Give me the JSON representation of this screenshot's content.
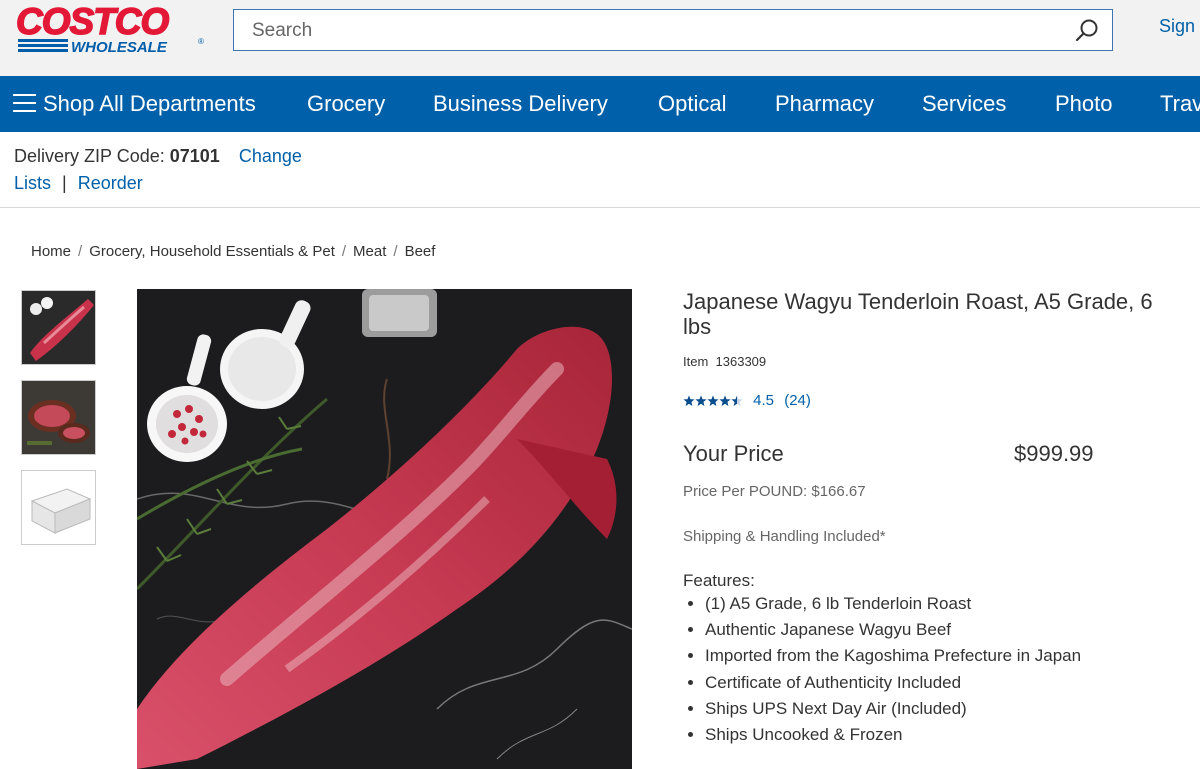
{
  "header": {
    "logo_text": "COSTCO",
    "logo_subtext": "WHOLESALE",
    "search_placeholder": "Search",
    "sign_in_label": "Sign",
    "colors": {
      "brand_red": "#e31837",
      "brand_blue": "#005daa",
      "header_bg": "#f2f2f2"
    }
  },
  "nav": {
    "shop_all": "Shop All Departments",
    "items": [
      "Grocery",
      "Business Delivery",
      "Optical",
      "Pharmacy",
      "Services",
      "Photo",
      "Trav"
    ],
    "bg_color": "#0060a9"
  },
  "delivery": {
    "zip_label": "Delivery ZIP Code:",
    "zip_code": "07101",
    "change_label": "Change",
    "lists_label": "Lists",
    "separator": "|",
    "reorder_label": "Reorder"
  },
  "breadcrumb": [
    "Home",
    "Grocery, Household Essentials & Pet",
    "Meat",
    "Beef"
  ],
  "product": {
    "title": "Japanese Wagyu Tenderloin Roast, A5 Grade, 6 lbs",
    "item_label": "Item",
    "item_number": "1363309",
    "rating_value": "4.5",
    "rating_count": "(24)",
    "rating_fraction": 0.9,
    "price_label": "Your Price",
    "price": "$999.99",
    "price_per": "Price Per POUND: $166.67",
    "shipping": "Shipping & Handling Included*",
    "features_title": "Features:",
    "features": [
      "(1) A5 Grade, 6 lb Tenderloin Roast",
      "Authentic Japanese Wagyu Beef",
      "Imported from the Kagoshima Prefecture in Japan",
      "Certificate of Authenticity Included",
      "Ships UPS Next Day Air (Included)",
      "Ships Uncooked & Frozen"
    ]
  },
  "thumbnails": [
    "tenderloin-thumb",
    "sliced-roast-thumb",
    "shipping-box-thumb"
  ]
}
